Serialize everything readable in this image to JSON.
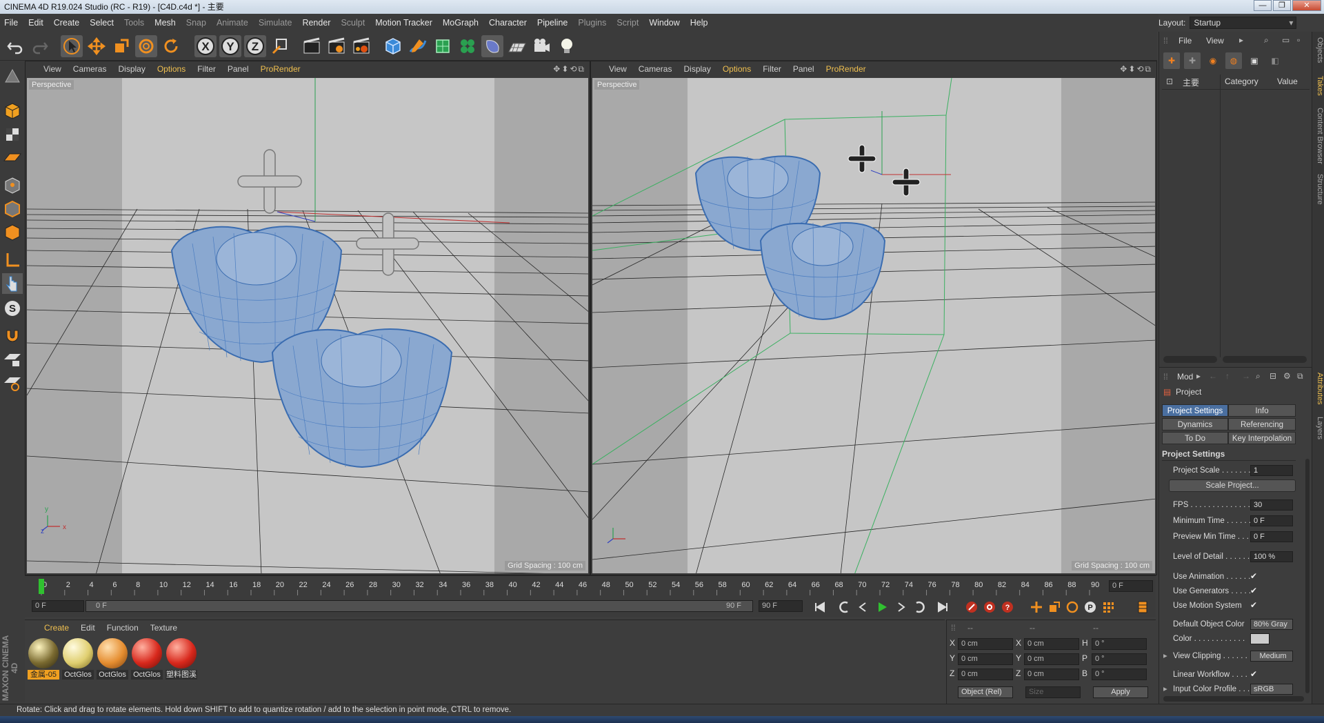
{
  "window": {
    "title": "CINEMA 4D R19.024 Studio (RC - R19) - [C4D.c4d *] - 主要",
    "min": "—",
    "max": "❐",
    "close": "✕"
  },
  "menu": [
    "File",
    "Edit",
    "Create",
    "Select",
    "Tools",
    "Mesh",
    "Snap",
    "Animate",
    "Simulate",
    "Render",
    "Sculpt",
    "Motion Tracker",
    "MoGraph",
    "Character",
    "Pipeline",
    "Plugins",
    "Script",
    "Window",
    "Help"
  ],
  "layout": {
    "label": "Layout:",
    "value": "Startup"
  },
  "toolbar": {
    "x_btn": "X",
    "y_btn": "Y",
    "z_btn": "Z"
  },
  "viewports": [
    {
      "menu": [
        "View",
        "Cameras",
        "Display",
        "Options",
        "Filter",
        "Panel",
        "ProRender"
      ],
      "label": "Perspective",
      "grid": "Grid Spacing : 100 cm",
      "nav": "✥⬍⟲⧉"
    },
    {
      "menu": [
        "View",
        "Cameras",
        "Display",
        "Options",
        "Filter",
        "Panel",
        "ProRender"
      ],
      "label": "Perspective",
      "grid": "Grid Spacing : 100 cm",
      "nav": "✥⬍⟲⧉"
    }
  ],
  "timeline": {
    "ticks": [
      "0",
      "2",
      "4",
      "6",
      "8",
      "10",
      "12",
      "14",
      "16",
      "18",
      "20",
      "22",
      "24",
      "26",
      "28",
      "30",
      "32",
      "34",
      "36",
      "38",
      "40",
      "42",
      "44",
      "46",
      "48",
      "50",
      "52",
      "54",
      "56",
      "58",
      "60",
      "62",
      "64",
      "66",
      "68",
      "70",
      "72",
      "74",
      "76",
      "78",
      "80",
      "82",
      "84",
      "86",
      "88",
      "90"
    ],
    "current": "0 F",
    "progress": 0.0
  },
  "playback": {
    "start": "0 F",
    "range_start": "0 F",
    "range_end": "90 F",
    "end": "90 F"
  },
  "material_menu": [
    "Create",
    "Edit",
    "Function",
    "Texture"
  ],
  "materials": [
    {
      "label": "金属-05",
      "color": "#7a6a30"
    },
    {
      "label": "OctGlos",
      "color": "#e0cf70"
    },
    {
      "label": "OctGlos",
      "color": "#e58d30"
    },
    {
      "label": "OctGlos",
      "color": "#d8281c"
    },
    {
      "label": "塑料图溪",
      "color": "#d8281c"
    }
  ],
  "coords": {
    "header": [
      "--",
      "--",
      "--"
    ],
    "rows": [
      {
        "a": "X",
        "av": "0 cm",
        "b": "X",
        "bv": "0 cm",
        "c": "H",
        "cv": "0 °"
      },
      {
        "a": "Y",
        "av": "0 cm",
        "b": "Y",
        "bv": "0 cm",
        "c": "P",
        "cv": "0 °"
      },
      {
        "a": "Z",
        "av": "0 cm",
        "b": "Z",
        "bv": "0 cm",
        "c": "B",
        "cv": "0 °"
      }
    ],
    "mode": "Object (Rel)",
    "size": "Size",
    "apply": "Apply"
  },
  "objects": {
    "menu": [
      "File",
      "View"
    ],
    "root": "主要",
    "col_category": "Category",
    "col_value": "Value"
  },
  "attributes": {
    "mode": "Mod",
    "title": "Project",
    "tabs": [
      "Project Settings",
      "Info",
      "Dynamics",
      "Referencing",
      "To Do",
      "Key Interpolation"
    ],
    "section": "Project Settings",
    "rows": [
      {
        "label": "Project Scale . . . . . . .",
        "value": "1"
      },
      {
        "label": "FPS . . . . . . . . . . . . . . . .",
        "value": "30"
      },
      {
        "label": "Minimum Time . . . . . .",
        "value": "0 F"
      },
      {
        "label": "Preview Min Time . . . .",
        "value": "0 F"
      },
      {
        "label": "Level of Detail . . . . . .",
        "value": "100 %"
      }
    ],
    "scale_btn": "Scale Project...",
    "checks": [
      {
        "label": "Use Animation . . . . . .",
        "value": "✔"
      },
      {
        "label": "Use Generators . . . . .",
        "value": "✔"
      },
      {
        "label": "Use Motion System",
        "value": "✔"
      }
    ],
    "default_color_label": "Default Object Color",
    "default_color": "80% Gray",
    "color_label": "Color . . . . . . . . . . . .",
    "view_clip_label": "View Clipping . . . . . .",
    "view_clip": "Medium",
    "linear_label": "Linear Workflow . . . .",
    "linear": "✔",
    "input_label": "Input Color Profile . . .",
    "input": "sRGB"
  },
  "side_tabs": [
    "Objects",
    "Takes",
    "Content Browser",
    "Structure",
    "Attributes",
    "Layers"
  ],
  "brand": "MAXON CINEMA 4D",
  "status": "Rotate: Click and drag to rotate elements. Hold down SHIFT to add to quantize rotation / add to the selection in point mode, CTRL to remove."
}
